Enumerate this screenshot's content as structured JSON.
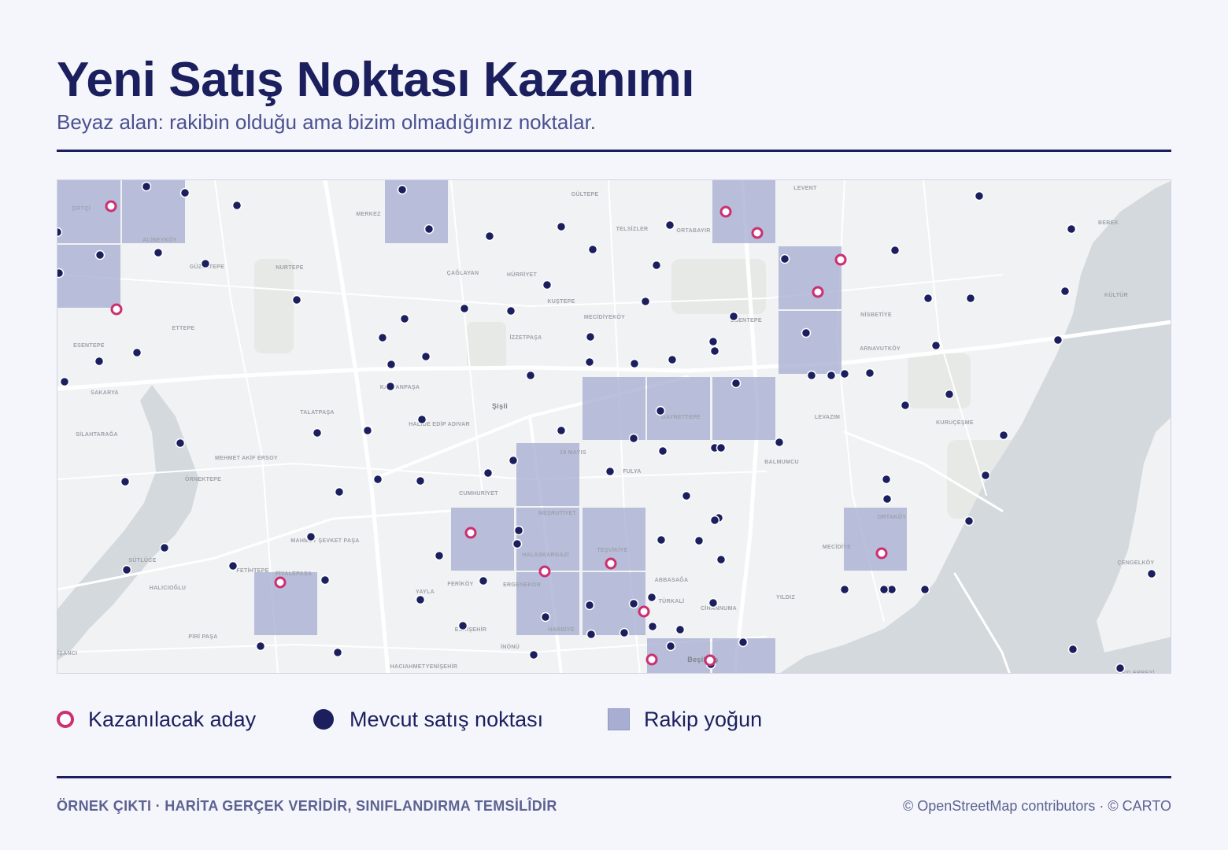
{
  "header": {
    "title": "Yeni Satış Noktası Kazanımı",
    "subtitle": "Beyaz alan: rakibin olduğu ama bizim olmadığımız noktalar."
  },
  "map": {
    "colors": {
      "land": "#f1f2f3",
      "water": "#d4d9dd",
      "road": "#ffffff",
      "competitor_cell": "#a8aed2",
      "existing_point": "#1b1f5e",
      "candidate_ring": "#cc2f72"
    },
    "place_labels": [
      "ÇİFTÇİ",
      "ALİBEYKÖY",
      "GÜZELTEPE",
      "ETTEPE",
      "ESENTEPE",
      "SAKARYA",
      "SİLAHTARAĞA",
      "NURTEPE",
      "MERKEZ",
      "ÇAĞLAYAN",
      "HÜRRİYET",
      "KUŞTEPE",
      "İZZETPAŞA",
      "GÜLTEPE",
      "TELSİZLER",
      "ORTABAYIR",
      "MECİDİYEKÖY",
      "ESENTEPE",
      "LEVENT",
      "NİSBETİYE",
      "ARNAVUTKÖY",
      "BEBEK",
      "KÜLTÜR",
      "Şişli",
      "HALİDE EDİP ADIVAR",
      "KAPTANPAŞA",
      "TALATPAŞA",
      "MEHMET AKİF ERSOY",
      "ÖRNEKTEPE",
      "19 MAYIS",
      "FULYA",
      "GAYRETTEPE",
      "LEVAZIM",
      "KURUÇEŞME",
      "BALMUMCU",
      "CUMHURİYET",
      "MEŞRUTİYET",
      "HALASKARGAZİ",
      "TEŞVİKİYE",
      "ERGENEKON",
      "HARBİYE",
      "ABBASAĞA",
      "TÜRKALİ",
      "CİHANNUMA",
      "YILDIZ",
      "MECİDİYE",
      "ORTAKÖY",
      "MAHMUT ŞEVKET PAŞA",
      "SÜTLÜCE",
      "HALICIOĞLU",
      "FETİHTEPE",
      "PİYALEPAŞA",
      "PİRİ PAŞA",
      "NİŞANCI",
      "YAYLA",
      "FERİKÖY",
      "ESKİŞEHİR",
      "İNÖNÜ",
      "HACIAHMET",
      "YENİŞEHİR",
      "Beşiktaş",
      "ÇENGELKÖY",
      "BEYLERBEYİ"
    ],
    "competitor_cells_count": 24,
    "existing_points_count": 126,
    "candidate_points_count": 14
  },
  "legend": {
    "candidate_label": "Kazanılacak aday",
    "existing_label": "Mevcut satış noktası",
    "competitor_label": "Rakip yoğun"
  },
  "footer": {
    "note": "ÖRNEK ÇIKTI · HARİTA GERÇEK VERİDİR, SINIFLANDIRMA TEMSİLÎDİR",
    "attribution": "© OpenStreetMap contributors · © CARTO"
  }
}
